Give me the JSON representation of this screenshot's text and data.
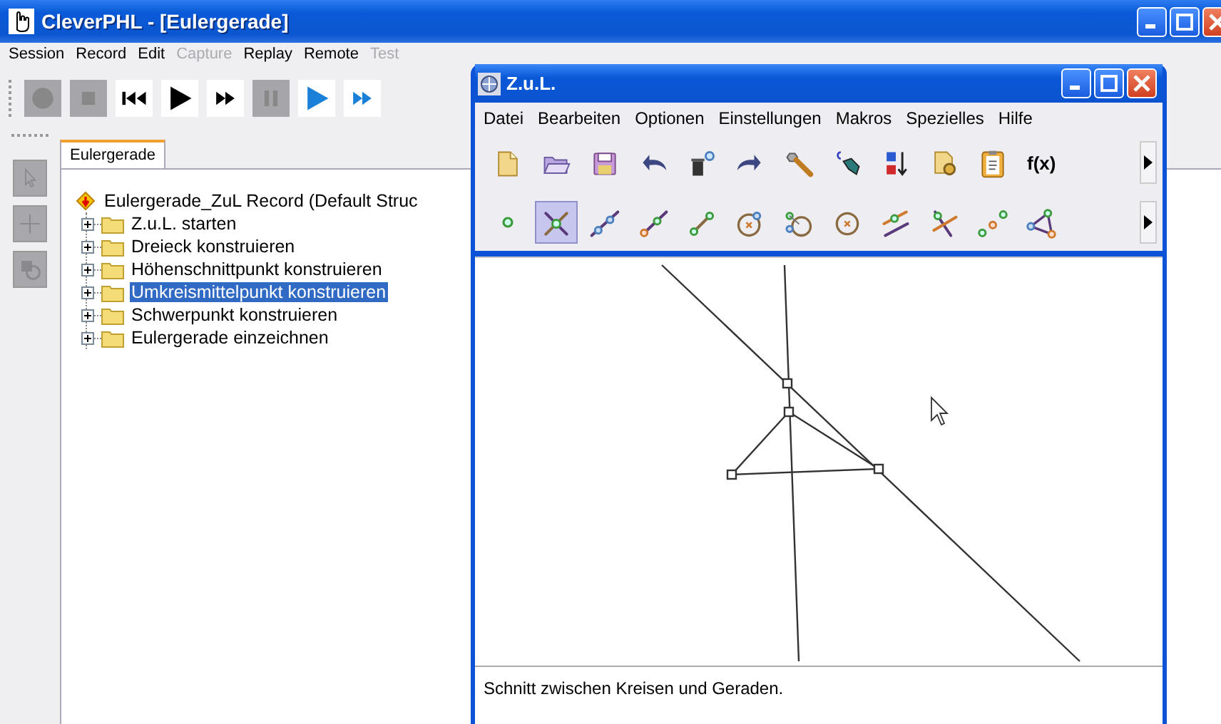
{
  "main_window": {
    "title": "CleverPHL - [Eulergerade]"
  },
  "menu": [
    {
      "label": "Session",
      "disabled": false
    },
    {
      "label": "Record",
      "disabled": false
    },
    {
      "label": "Edit",
      "disabled": false
    },
    {
      "label": "Capture",
      "disabled": true
    },
    {
      "label": "Replay",
      "disabled": false
    },
    {
      "label": "Remote",
      "disabled": false
    },
    {
      "label": "Test",
      "disabled": true
    }
  ],
  "toolbar": [
    {
      "kind": "record",
      "disabled": true
    },
    {
      "kind": "stop",
      "disabled": true
    },
    {
      "kind": "skip-back",
      "disabled": false
    },
    {
      "kind": "play",
      "disabled": false
    },
    {
      "kind": "fast-forward",
      "disabled": false
    },
    {
      "kind": "pause",
      "disabled": true
    },
    {
      "kind": "replay",
      "disabled": false
    },
    {
      "kind": "replay-fast",
      "disabled": false
    }
  ],
  "side_tools": [
    {
      "kind": "pointer",
      "disabled": true
    },
    {
      "kind": "plus",
      "disabled": true
    },
    {
      "kind": "shapes",
      "disabled": true
    }
  ],
  "tabs": [
    {
      "label": "Eulergerade",
      "selected": true
    }
  ],
  "tree": {
    "label": "Eulergerade_ZuL Record (Default Struc",
    "children": [
      {
        "label": "Z.u.L. starten",
        "expanded": false,
        "selected": false
      },
      {
        "label": "Dreieck konstruieren",
        "expanded": false,
        "selected": false
      },
      {
        "label": "Höhenschnittpunkt konstruieren",
        "expanded": false,
        "selected": false
      },
      {
        "label": "Umkreismittelpunkt konstruieren",
        "expanded": false,
        "selected": true
      },
      {
        "label": "Schwerpunkt konstruieren",
        "expanded": false,
        "selected": false
      },
      {
        "label": "Eulergerade einzeichnen",
        "expanded": false,
        "selected": false
      }
    ]
  },
  "zul_window": {
    "title": "Z.u.L.",
    "menu": [
      "Datei",
      "Bearbeiten",
      "Optionen",
      "Einstellungen",
      "Makros",
      "Spezielles",
      "Hilfe"
    ],
    "toolbar_rows": [
      [
        {
          "kind": "new-document"
        },
        {
          "kind": "open-folder"
        },
        {
          "kind": "save"
        },
        {
          "kind": "undo"
        },
        {
          "kind": "delete-point"
        },
        {
          "kind": "redo"
        },
        {
          "kind": "wrench"
        },
        {
          "kind": "pen"
        },
        {
          "kind": "sort"
        },
        {
          "kind": "document-gear"
        },
        {
          "kind": "clipboard"
        },
        {
          "kind": "text",
          "label": "f(x)"
        }
      ],
      [
        {
          "kind": "point",
          "selected": false
        },
        {
          "kind": "intersection",
          "selected": true
        },
        {
          "kind": "line",
          "selected": false
        },
        {
          "kind": "ray",
          "selected": false
        },
        {
          "kind": "segment",
          "selected": false
        },
        {
          "kind": "circle",
          "selected": false
        },
        {
          "kind": "circle-points",
          "selected": false
        },
        {
          "kind": "circle-radius",
          "selected": false
        },
        {
          "kind": "parallel",
          "selected": false
        },
        {
          "kind": "perpendicular",
          "selected": false
        },
        {
          "kind": "midpoint",
          "selected": false
        },
        {
          "kind": "triangle",
          "selected": false
        }
      ]
    ],
    "status": "Schnitt zwischen Kreisen und Geraden."
  }
}
